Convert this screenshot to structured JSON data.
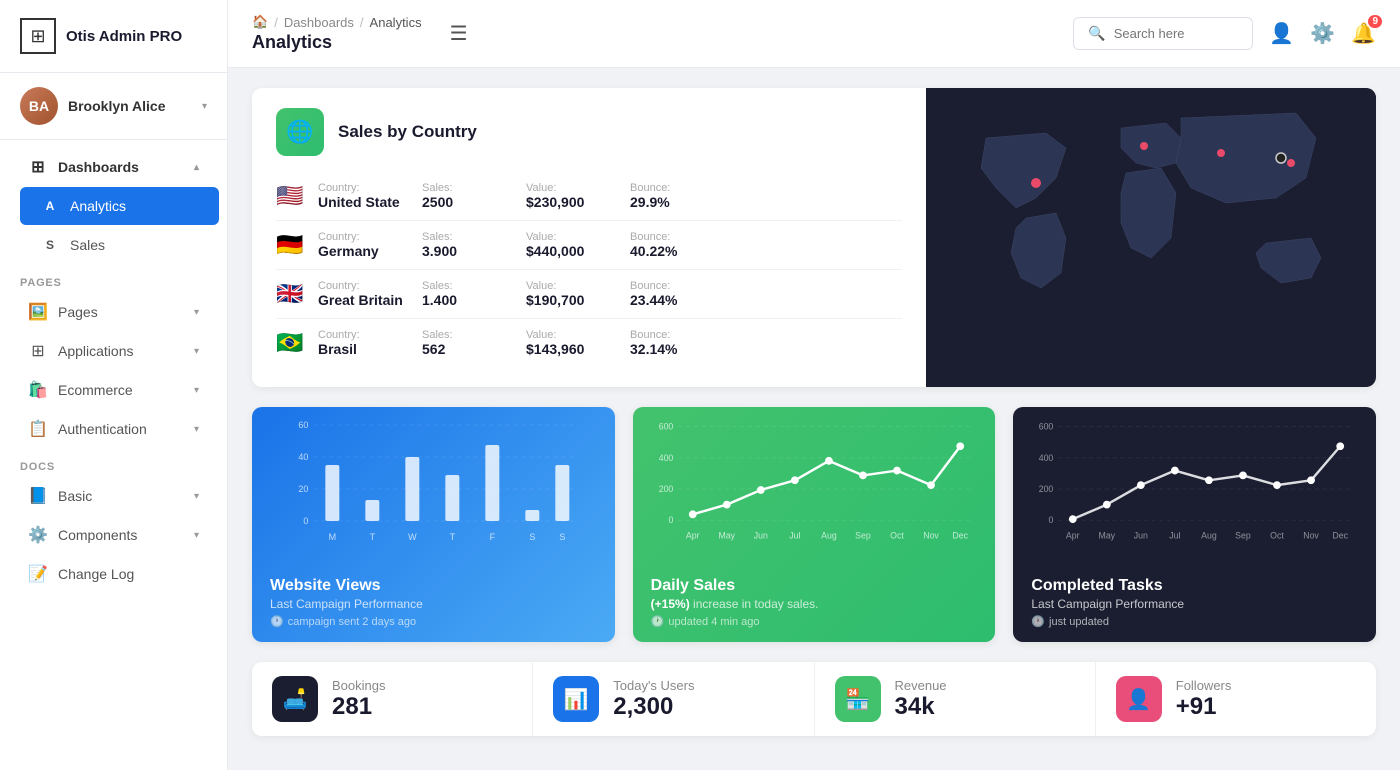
{
  "app": {
    "name": "Otis Admin PRO"
  },
  "user": {
    "name": "Brooklyn Alice",
    "initials": "BA"
  },
  "header": {
    "breadcrumb": [
      "🏠",
      "/",
      "Dashboards",
      "/",
      "Analytics"
    ],
    "title": "Analytics",
    "hamburger": "☰",
    "search_placeholder": "Search here",
    "notif_count": "9"
  },
  "sidebar": {
    "dashboards_label": "Dashboards",
    "analytics_label": "Analytics",
    "sales_label": "Sales",
    "pages_section": "PAGES",
    "pages_label": "Pages",
    "applications_label": "Applications",
    "ecommerce_label": "Ecommerce",
    "authentication_label": "Authentication",
    "docs_section": "DOCS",
    "basic_label": "Basic",
    "components_label": "Components",
    "changelog_label": "Change Log"
  },
  "sales_card": {
    "title": "Sales by Country",
    "rows": [
      {
        "flag": "🇺🇸",
        "country_label": "Country:",
        "country": "United State",
        "sales_label": "Sales:",
        "sales": "2500",
        "value_label": "Value:",
        "value": "$230,900",
        "bounce_label": "Bounce:",
        "bounce": "29.9%"
      },
      {
        "flag": "🇩🇪",
        "country_label": "Country:",
        "country": "Germany",
        "sales_label": "Sales:",
        "sales": "3.900",
        "value_label": "Value:",
        "value": "$440,000",
        "bounce_label": "Bounce:",
        "bounce": "40.22%"
      },
      {
        "flag": "🇬🇧",
        "country_label": "Country:",
        "country": "Great Britain",
        "sales_label": "Sales:",
        "sales": "1.400",
        "value_label": "Value:",
        "value": "$190,700",
        "bounce_label": "Bounce:",
        "bounce": "23.44%"
      },
      {
        "flag": "🇧🇷",
        "country_label": "Country:",
        "country": "Brasil",
        "sales_label": "Sales:",
        "sales": "562",
        "value_label": "Value:",
        "value": "$143,960",
        "bounce_label": "Bounce:",
        "bounce": "32.14%"
      }
    ]
  },
  "charts": {
    "website_views": {
      "title": "Website Views",
      "subtitle": "Last Campaign Performance",
      "timestamp": "campaign sent 2 days ago",
      "y_labels": [
        "60",
        "40",
        "20",
        "0"
      ],
      "x_labels": [
        "M",
        "T",
        "W",
        "T",
        "F",
        "S",
        "S"
      ]
    },
    "daily_sales": {
      "title": "Daily Sales",
      "highlight": "(+15%)",
      "subtitle": " increase in today sales.",
      "timestamp": "updated 4 min ago",
      "y_labels": [
        "600",
        "400",
        "200",
        "0"
      ],
      "x_labels": [
        "Apr",
        "May",
        "Jun",
        "Jul",
        "Aug",
        "Sep",
        "Oct",
        "Nov",
        "Dec"
      ]
    },
    "completed_tasks": {
      "title": "Completed Tasks",
      "subtitle": "Last Campaign Performance",
      "timestamp": "just updated",
      "y_labels": [
        "600",
        "400",
        "200",
        "0"
      ],
      "x_labels": [
        "Apr",
        "May",
        "Jun",
        "Jul",
        "Aug",
        "Sep",
        "Oct",
        "Nov",
        "Dec"
      ]
    }
  },
  "stats": [
    {
      "icon": "🛋️",
      "icon_class": "stat-icon-dark",
      "label": "Bookings",
      "value": "281"
    },
    {
      "icon": "📊",
      "icon_class": "stat-icon-blue",
      "label": "Today's Users",
      "value": "2,300"
    },
    {
      "icon": "🏪",
      "icon_class": "stat-icon-green",
      "label": "Revenue",
      "value": "34k"
    },
    {
      "icon": "👤",
      "icon_class": "stat-icon-pink",
      "label": "Followers",
      "value": "+91"
    }
  ]
}
